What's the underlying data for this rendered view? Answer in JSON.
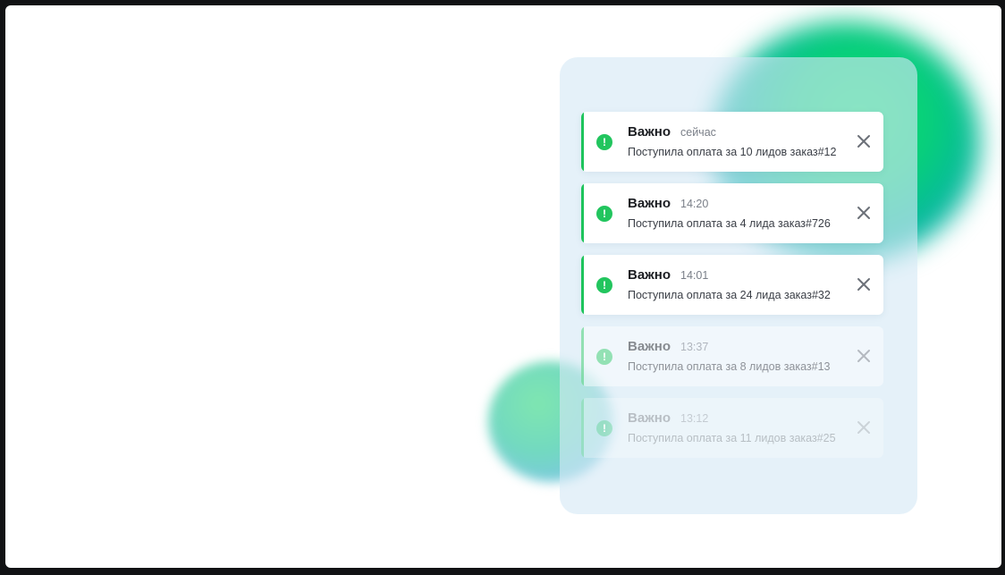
{
  "notifications": [
    {
      "title": "Важно",
      "time": "сейчас",
      "message": "Поступила оплата за 10 лидов заказ#12",
      "status_icon": "exclamation-icon",
      "close_icon": "close-icon"
    },
    {
      "title": "Важно",
      "time": "14:20",
      "message": "Поступила оплата за 4 лида заказ#726",
      "status_icon": "exclamation-icon",
      "close_icon": "close-icon"
    },
    {
      "title": "Важно",
      "time": "14:01",
      "message": "Поступила оплата за 24 лида заказ#32",
      "status_icon": "exclamation-icon",
      "close_icon": "close-icon"
    },
    {
      "title": "Важно",
      "time": "13:37",
      "message": "Поступила оплата за 8 лидов заказ#13",
      "status_icon": "exclamation-icon",
      "close_icon": "close-icon"
    },
    {
      "title": "Важно",
      "time": "13:12",
      "message": "Поступила оплата за 11 лидов заказ#25",
      "status_icon": "exclamation-icon",
      "close_icon": "close-icon"
    }
  ],
  "colors": {
    "accent": "#22c55e",
    "panel": "#d5e8f5",
    "card": "#ffffff"
  }
}
